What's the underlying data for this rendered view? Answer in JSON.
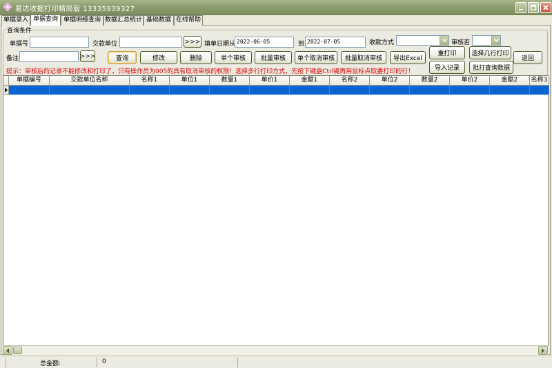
{
  "window": {
    "title": "易达收据打印精简版  13335939327",
    "minimize_label": "minimize",
    "maximize_label": "maximize",
    "close_label": "close"
  },
  "tabs": [
    {
      "label": "单据录入",
      "active": false
    },
    {
      "label": "单据查询",
      "active": true
    },
    {
      "label": "单据明细查询",
      "active": false
    },
    {
      "label": "数据汇总统计",
      "active": false
    },
    {
      "label": "基础数据",
      "active": false
    },
    {
      "label": "在线帮助",
      "active": false
    }
  ],
  "query": {
    "group_title": "查询条件",
    "doc_no_label": "单据号",
    "doc_no_value": "",
    "payer_label": "交款单位",
    "payer_value": "",
    "payer_browse": ">>>",
    "date_from_label": "填单日期从",
    "date_from": "2022-06-05",
    "date_to_label": "到",
    "date_to": "2022-07-05",
    "pay_method_label": "收款方式",
    "pay_method_value": "",
    "audit_label": "审核否",
    "audit_value": "",
    "remark_label": "备注",
    "remark_value": "",
    "remark_browse": ">>>"
  },
  "buttons": {
    "search": "查询",
    "edit": "修改",
    "delete": "删除",
    "single_audit": "单个审核",
    "batch_audit": "批量审核",
    "single_unaudit": "单个取消审核",
    "batch_unaudit": "批量取消审核",
    "export_excel": "导出Excel",
    "reprint": "重打印",
    "select_rows_print": "选择几行打印",
    "back": "返回",
    "import_records": "导入记录",
    "batch_print_query": "批打查询数据"
  },
  "hint": "提示：审核后的记录不能修改和打印了，只有操作员为005的具有取消审核的权限！选择多行打印方式，先按下键盘Ctrl键再用鼠标点取要打印的行！",
  "grid": {
    "columns": [
      "单据编号",
      "交款单位名称",
      "名称1",
      "单位1",
      "数量1",
      "单价1",
      "金额1",
      "名称2",
      "单位2",
      "数量2",
      "单价2",
      "金额2",
      "名称3"
    ],
    "rows": [
      [
        "",
        "",
        "",
        "",
        "",
        "",
        "",
        "",
        "",
        "",
        "",
        "",
        ""
      ]
    ]
  },
  "status": {
    "total_label": "总金额:",
    "total_value": "0"
  }
}
